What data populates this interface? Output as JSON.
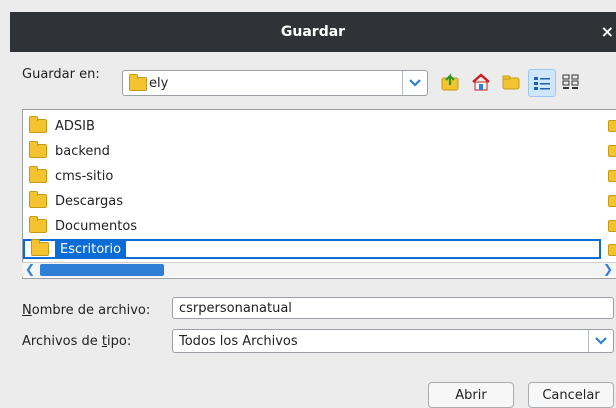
{
  "window": {
    "title": "Guardar",
    "close_glyph": "×"
  },
  "save_in": {
    "label": "Guardar en:",
    "value": "ely"
  },
  "toolbar": {
    "icons": [
      "up-folder-icon",
      "home-icon",
      "new-folder-icon",
      "list-view-icon",
      "details-view-icon"
    ]
  },
  "files": [
    {
      "name": "ADSIB"
    },
    {
      "name": "backend"
    },
    {
      "name": "cms-sitio"
    },
    {
      "name": "Descargas"
    },
    {
      "name": "Documentos"
    },
    {
      "name": "Escritorio",
      "selected": true
    }
  ],
  "filename": {
    "label": "Nombre de archivo:",
    "value": "csrpersonanatual"
  },
  "filetype": {
    "label": "Archivos de tipo:",
    "value": "Todos los Archivos"
  },
  "buttons": {
    "open": "Abrir",
    "cancel": "Cancelar"
  },
  "colors": {
    "titlebar": "#2f3337",
    "accent": "#0b6cd6",
    "folder": "#f4c430"
  }
}
